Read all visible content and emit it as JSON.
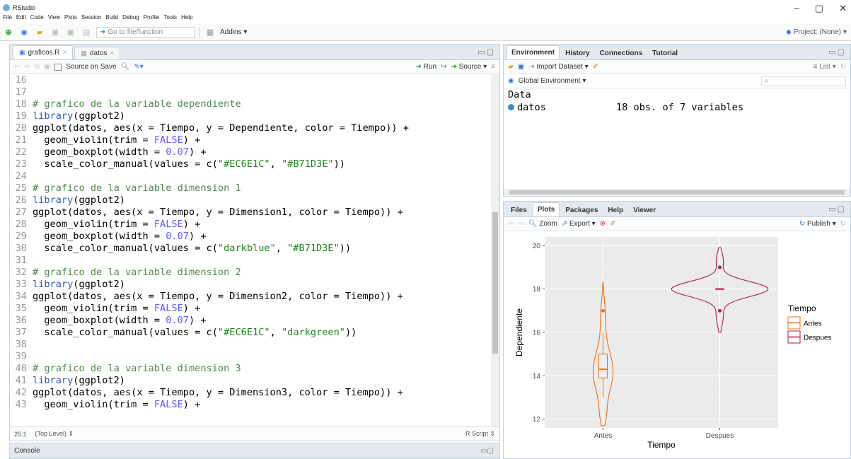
{
  "window": {
    "title": "RStudio"
  },
  "menu": [
    "File",
    "Edit",
    "Code",
    "View",
    "Plots",
    "Session",
    "Build",
    "Debug",
    "Profile",
    "Tools",
    "Help"
  ],
  "toolbar": {
    "goto_placeholder": "Go to file/function",
    "addins": "Addins",
    "project": "Project: (None)"
  },
  "editor": {
    "tabs": [
      {
        "label": "graficos.R"
      },
      {
        "label": "datos"
      }
    ],
    "source_on_save": "Source on Save",
    "run": "Run",
    "source": "Source",
    "lines": [
      {
        "n": "16",
        "t": []
      },
      {
        "n": "17",
        "t": []
      },
      {
        "n": "18",
        "t": [
          [
            "cm",
            "# grafico de la variable dependiente"
          ]
        ]
      },
      {
        "n": "19",
        "t": [
          [
            "fn",
            "library"
          ],
          [
            "code",
            "(ggplot2)"
          ]
        ]
      },
      {
        "n": "20",
        "t": [
          [
            "code",
            "ggplot(datos, aes(x = Tiempo, y = Dependiente, color = Tiempo)) +"
          ]
        ]
      },
      {
        "n": "21",
        "t": [
          [
            "code",
            "  geom_violin(trim = "
          ],
          [
            "kw",
            "FALSE"
          ],
          [
            "code",
            ") +"
          ]
        ]
      },
      {
        "n": "22",
        "t": [
          [
            "code",
            "  geom_boxplot(width = "
          ],
          [
            "num",
            "0.07"
          ],
          [
            "code",
            ") +"
          ]
        ]
      },
      {
        "n": "23",
        "t": [
          [
            "code",
            "  scale_color_manual(values = c("
          ],
          [
            "str",
            "\"#EC6E1C\""
          ],
          [
            "code",
            ", "
          ],
          [
            "str",
            "\"#B71D3E\""
          ],
          [
            "code",
            "))"
          ]
        ]
      },
      {
        "n": "24",
        "t": []
      },
      {
        "n": "25",
        "t": [
          [
            "cm",
            "# grafico de la variable dimension 1"
          ]
        ]
      },
      {
        "n": "26",
        "t": [
          [
            "fn",
            "library"
          ],
          [
            "code",
            "(ggplot2)"
          ]
        ]
      },
      {
        "n": "27",
        "t": [
          [
            "code",
            "ggplot(datos, aes(x = Tiempo, y = Dimension1, color = Tiempo)) +"
          ]
        ]
      },
      {
        "n": "28",
        "t": [
          [
            "code",
            "  geom_violin(trim = "
          ],
          [
            "kw",
            "FALSE"
          ],
          [
            "code",
            ") +"
          ]
        ]
      },
      {
        "n": "29",
        "t": [
          [
            "code",
            "  geom_boxplot(width = "
          ],
          [
            "num",
            "0.07"
          ],
          [
            "code",
            ") +"
          ]
        ]
      },
      {
        "n": "30",
        "t": [
          [
            "code",
            "  scale_color_manual(values = c("
          ],
          [
            "str",
            "\"darkblue\""
          ],
          [
            "code",
            ", "
          ],
          [
            "str",
            "\"#B71D3E\""
          ],
          [
            "code",
            "))"
          ]
        ]
      },
      {
        "n": "31",
        "t": []
      },
      {
        "n": "32",
        "t": [
          [
            "cm",
            "# grafico de la variable dimension 2"
          ]
        ]
      },
      {
        "n": "33",
        "t": [
          [
            "fn",
            "library"
          ],
          [
            "code",
            "(ggplot2)"
          ]
        ]
      },
      {
        "n": "34",
        "t": [
          [
            "code",
            "ggplot(datos, aes(x = Tiempo, y = Dimension2, color = Tiempo)) +"
          ]
        ]
      },
      {
        "n": "35",
        "t": [
          [
            "code",
            "  geom_violin(trim = "
          ],
          [
            "kw",
            "FALSE"
          ],
          [
            "code",
            ") +"
          ]
        ]
      },
      {
        "n": "36",
        "t": [
          [
            "code",
            "  geom_boxplot(width = "
          ],
          [
            "num",
            "0.07"
          ],
          [
            "code",
            ") +"
          ]
        ]
      },
      {
        "n": "37",
        "t": [
          [
            "code",
            "  scale_color_manual(values = c("
          ],
          [
            "str",
            "\"#EC6E1C\""
          ],
          [
            "code",
            ", "
          ],
          [
            "str",
            "\"darkgreen\""
          ],
          [
            "code",
            "))"
          ]
        ]
      },
      {
        "n": "38",
        "t": []
      },
      {
        "n": "39",
        "t": []
      },
      {
        "n": "40",
        "t": [
          [
            "cm",
            "# grafico de la variable dimension 3"
          ]
        ]
      },
      {
        "n": "41",
        "t": [
          [
            "fn",
            "library"
          ],
          [
            "code",
            "(ggplot2)"
          ]
        ]
      },
      {
        "n": "42",
        "t": [
          [
            "code",
            "ggplot(datos, aes(x = Tiempo, y = Dimension3, color = Tiempo)) +"
          ]
        ]
      },
      {
        "n": "43",
        "t": [
          [
            "code",
            "  geom_violin(trim = "
          ],
          [
            "kw",
            "FALSE"
          ],
          [
            "code",
            ") +"
          ]
        ]
      }
    ],
    "status_pos": "25:1",
    "status_scope": "(Top Level)",
    "status_type": "R Script"
  },
  "console": {
    "label": "Console"
  },
  "env": {
    "tabs": [
      "Environment",
      "History",
      "Connections",
      "Tutorial"
    ],
    "import": "Import Dataset",
    "list": "List",
    "scope": "Global Environment",
    "section": "Data",
    "rows": [
      {
        "name": "datos",
        "value": "18 obs. of 7 variables"
      }
    ]
  },
  "plots": {
    "tabs": [
      "Files",
      "Plots",
      "Packages",
      "Help",
      "Viewer"
    ],
    "zoom": "Zoom",
    "export": "Export",
    "publish": "Publish"
  },
  "chart_data": {
    "type": "violin",
    "xlabel": "Tiempo",
    "ylabel": "Dependiente",
    "categories": [
      "Antes",
      "Despues"
    ],
    "ylim": [
      11.6,
      20.4
    ],
    "yticks": [
      12,
      14,
      16,
      18,
      20
    ],
    "legend_title": "Tiempo",
    "legend_position": "right",
    "series": [
      {
        "name": "Antes",
        "color": "#EC6E1C",
        "violin_min": 11.7,
        "violin_max": 18.3,
        "median": 14.3,
        "q1": 13.9,
        "q3": 15.0,
        "whisker_low": 13.0,
        "whisker_high": 16.0,
        "outliers": [
          17.0
        ]
      },
      {
        "name": "Despues",
        "color": "#B71D3E",
        "violin_min": 16.0,
        "violin_max": 19.9,
        "median": 18.0,
        "q1": 18.0,
        "q3": 18.0,
        "whisker_low": 18.0,
        "whisker_high": 18.0,
        "outliers": [
          19.0,
          17.0
        ]
      }
    ]
  }
}
